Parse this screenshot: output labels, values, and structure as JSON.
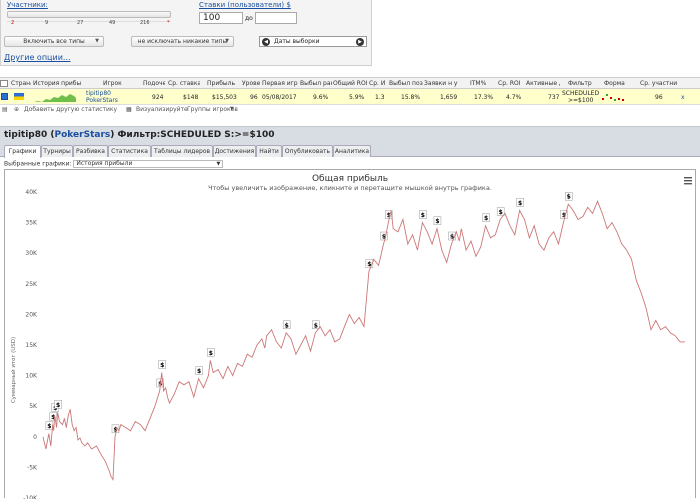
{
  "filters": {
    "participants_label": "Участники:",
    "slider_ticks": [
      "2",
      "9",
      "27",
      "49",
      "216",
      "*"
    ],
    "stakes_label": "Ставки (пользователи) $",
    "stake_from": "100",
    "stake_to": "",
    "to_label": "до",
    "types_dropdown": "Включить все типы",
    "exclude_dropdown": "не исключать никакие типы",
    "dates_label": "Даты выборки",
    "other_options": "Другие опции..."
  },
  "table": {
    "headers": [
      "Страна",
      "История прибыл",
      "Игрок",
      "Подоче",
      "Ср. ставка",
      "Прибыль",
      "Урове",
      "Первая игр",
      "Выбыл ран",
      "Общий ROI",
      "Ср. И",
      "Выбыл позд",
      "Заявки н у",
      "ITM%",
      "Ср. ROI",
      "Активные д",
      "Фильтр",
      "Форма",
      "Ср. участни"
    ],
    "row": {
      "player": "tipitip80",
      "network": "PokerStars",
      "count": "924",
      "avg_stake": "$148",
      "profit": "$15,503",
      "level": "96",
      "first_game": "05/08/2017",
      "early_out": "9.6%",
      "total_roi": "5.9%",
      "avg_i": "1.3",
      "late_out": "15.8%",
      "entries": "1,659",
      "itm": "17.3%",
      "avg_roi": "4.7%",
      "active_days": "737",
      "filter_line1": "SCHEDULED",
      "filter_line2": ">=$100",
      "avg_participants": "96",
      "x_mark": "x"
    },
    "add_stat": "Добавить другую статистику",
    "visualize": "Визуализируйте",
    "player_groups": "Группы игроков"
  },
  "title": {
    "player": "tipitip80",
    "network": "PokerStars",
    "filter": "Фильтр:SCHEDULED S:>=$100"
  },
  "tabs": [
    "Графики",
    "Турниры",
    "Разбивка",
    "Статистика",
    "Таблицы лидеров",
    "Достижения",
    "Найти",
    "Опубликовать",
    "Аналитика"
  ],
  "chart_selector": {
    "label": "Выбранные графики:",
    "value": "История прибыли"
  },
  "chart_data": {
    "type": "line",
    "title": "Общая прибыль",
    "subtitle": "Чтобы увеличить изображение, кликните и перетащите мышкой внутрь графика.",
    "ylabel": "Суммарный итог (USD)",
    "ylim": [
      -10000,
      40000
    ],
    "y_ticks": [
      "40K",
      "35K",
      "30K",
      "25K",
      "20K",
      "15K",
      "10K",
      "5K",
      "0",
      "-5K",
      "-10K"
    ],
    "series_color": "#c77",
    "x": [
      0,
      3,
      6,
      8,
      10,
      11,
      12,
      14,
      15,
      17,
      20,
      22,
      24,
      26,
      28,
      30,
      32,
      34,
      36,
      38,
      40,
      43,
      46,
      50,
      55,
      60,
      64,
      68,
      70,
      72,
      74,
      76,
      78,
      80,
      85,
      90,
      95,
      100,
      105,
      110,
      115,
      120,
      122,
      124,
      126,
      128,
      130,
      135,
      140,
      145,
      150,
      155,
      160,
      165,
      170,
      172,
      175,
      180,
      185,
      190,
      195,
      200,
      205,
      210,
      215,
      220,
      225,
      228,
      230,
      235,
      240,
      245,
      250,
      255,
      260,
      265,
      270,
      275,
      280,
      285,
      290,
      295,
      300,
      305,
      310,
      315,
      320,
      325,
      330,
      335,
      340,
      345,
      350,
      352,
      355,
      358,
      360,
      365,
      370,
      375,
      380,
      385,
      390,
      395,
      400,
      405,
      410,
      415,
      420,
      425,
      428,
      430,
      435,
      440,
      445,
      450,
      455,
      460,
      465,
      470,
      475,
      480,
      485,
      490,
      495,
      500,
      505,
      510,
      515,
      520,
      525,
      530,
      535,
      540,
      545,
      550,
      555,
      560,
      565,
      570,
      575,
      580,
      585,
      590,
      595,
      600,
      605,
      610,
      615,
      620,
      625,
      630,
      635,
      640,
      645,
      650,
      655,
      660
    ],
    "values": [
      0,
      -2000,
      500,
      -1500,
      2000,
      1000,
      3500,
      1500,
      4000,
      2500,
      2000,
      3000,
      1500,
      3500,
      4500,
      2000,
      1000,
      1500,
      -500,
      -200,
      -1000,
      -1500,
      -1000,
      -2000,
      -1500,
      -3000,
      -4000,
      -5500,
      -6500,
      -7000,
      0,
      1500,
      1000,
      2000,
      1500,
      1000,
      2500,
      2000,
      1000,
      3000,
      5000,
      7500,
      10500,
      7500,
      8000,
      6500,
      5500,
      7000,
      9000,
      8500,
      9000,
      6500,
      9500,
      8000,
      10000,
      12500,
      10500,
      11000,
      9500,
      11500,
      10000,
      12000,
      11500,
      13500,
      13000,
      15000,
      16000,
      14500,
      16500,
      17500,
      15500,
      14500,
      17000,
      16000,
      13500,
      15000,
      16500,
      14000,
      17000,
      18000,
      16500,
      17500,
      15500,
      16000,
      18000,
      20000,
      18500,
      19500,
      18000,
      27000,
      29000,
      28000,
      31500,
      32500,
      35000,
      37000,
      34000,
      33500,
      35500,
      31500,
      33000,
      30500,
      35000,
      33500,
      31500,
      34000,
      30500,
      28500,
      31500,
      33500,
      32000,
      34000,
      30500,
      32000,
      29500,
      31000,
      34500,
      32500,
      33000,
      35500,
      36500,
      34500,
      33000,
      37000,
      35500,
      32500,
      34500,
      31500,
      30500,
      32500,
      33500,
      31500,
      35000,
      38000,
      37000,
      35500,
      36000,
      37500,
      36500,
      38500,
      36500,
      34000,
      35000,
      33500,
      31500,
      30500,
      29000,
      25500,
      23500,
      21000,
      17500,
      19000,
      17500,
      18000,
      17000,
      16500,
      15500,
      15500
    ]
  }
}
